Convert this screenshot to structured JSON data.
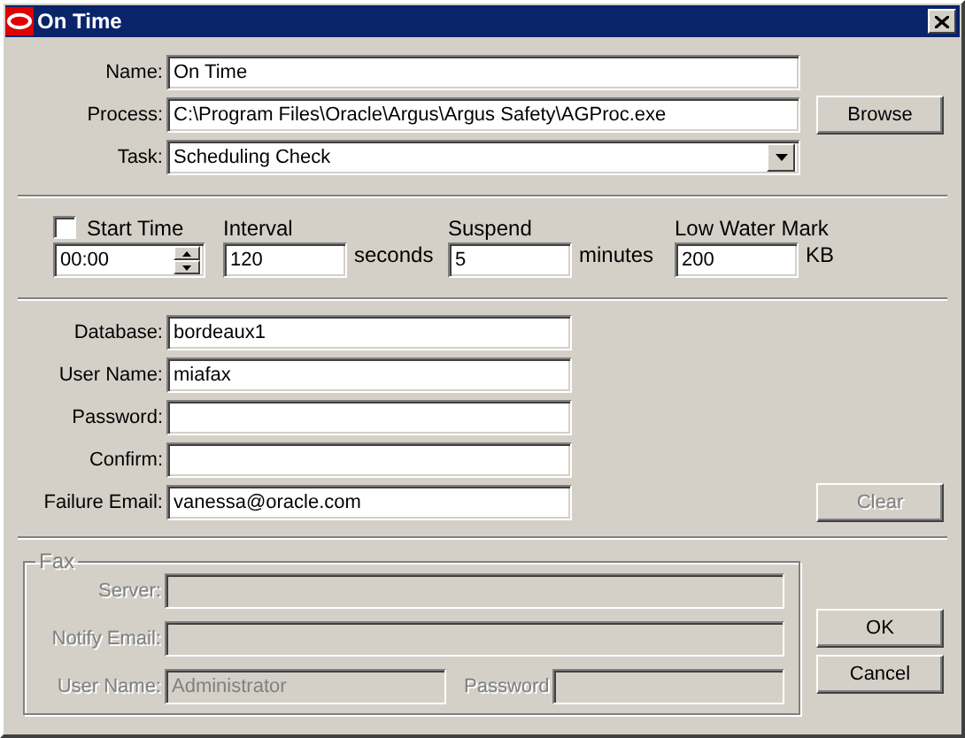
{
  "window": {
    "title": "On Time"
  },
  "general": {
    "fields": [
      {
        "kind": "text",
        "label": "Name:",
        "value": "On Time"
      },
      {
        "kind": "text",
        "label": "Process:",
        "value": "C:\\Program Files\\Oracle\\Argus\\Argus Safety\\AGProc.exe"
      },
      {
        "kind": "dropdown",
        "label": "Task:",
        "value": "Scheduling Check"
      }
    ],
    "browse_button": {
      "label": "Browse"
    }
  },
  "schedule": {
    "start_time": {
      "label": "Start Time",
      "checked": false,
      "value": "00:00"
    },
    "interval": {
      "label": "Interval",
      "value": "120",
      "unit": "seconds"
    },
    "suspend": {
      "label": "Suspend",
      "value": "5",
      "unit": "minutes"
    },
    "low_water_mark": {
      "label": "Low Water Mark",
      "value": "200",
      "unit": "KB"
    }
  },
  "database": {
    "fields": [
      {
        "label": "Database:",
        "value": "bordeaux1"
      },
      {
        "label": "User Name:",
        "value": "miafax"
      },
      {
        "label": "Password:"
      },
      {
        "label": "Confirm:"
      },
      {
        "label": "Failure Email:",
        "value": "vanessa@oracle.com"
      }
    ],
    "clear_button": {
      "label": "Clear",
      "disabled": true
    }
  },
  "fax": {
    "title": "Fax",
    "disabled": true,
    "server": {
      "label": "Server:"
    },
    "notify_email": {
      "label": "Notify Email:"
    },
    "user_name": {
      "label": "User Name:",
      "value": "Administrator"
    },
    "password": {
      "label": "Password"
    }
  },
  "buttons": [
    {
      "label": "OK"
    },
    {
      "label": "Cancel"
    }
  ]
}
